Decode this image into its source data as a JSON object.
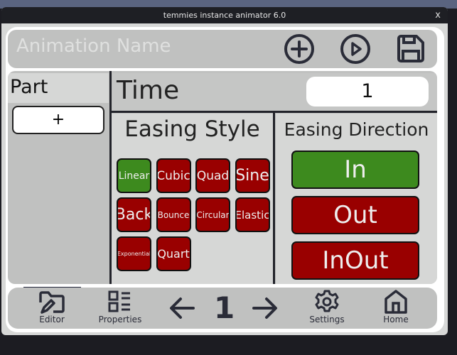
{
  "window": {
    "title": "temmies instance animator 6.0",
    "close": "x"
  },
  "header": {
    "name_placeholder": "Animation Name"
  },
  "part": {
    "label": "Part",
    "add": "+"
  },
  "time": {
    "label": "Time",
    "value": "1"
  },
  "easing_style": {
    "title": "Easing Style",
    "selected": "Linear",
    "items": [
      "Linear",
      "Cubic",
      "Quad",
      "Sine",
      "Back",
      "Bounce",
      "Circular",
      "Elastic",
      "Exponential",
      "Quart"
    ]
  },
  "easing_direction": {
    "title": "Easing Direction",
    "selected": "In",
    "items": [
      "In",
      "Out",
      "InOut"
    ]
  },
  "bottom": {
    "editor": "Editor",
    "properties": "Properties",
    "page": "1",
    "settings": "Settings",
    "home": "Home",
    "active": "Editor"
  },
  "colors": {
    "selected": "#3d8a1e",
    "unselected": "#990000",
    "panel": "#c0c1c0"
  }
}
